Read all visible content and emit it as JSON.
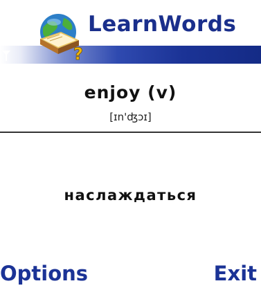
{
  "app": {
    "title": "LearnWords",
    "icon": "book-globe-question-icon"
  },
  "status": {
    "signal_icon": "signal-strength-icon"
  },
  "card": {
    "word": "enjoy (v)",
    "transcription": "[ɪn'ʤɔɪ]",
    "translation": "наслаждаться"
  },
  "softkeys": {
    "left_label": "Options",
    "right_label": "Exit"
  },
  "colors": {
    "brand_blue": "#1b3396",
    "title_blue": "#1a2f8c"
  }
}
